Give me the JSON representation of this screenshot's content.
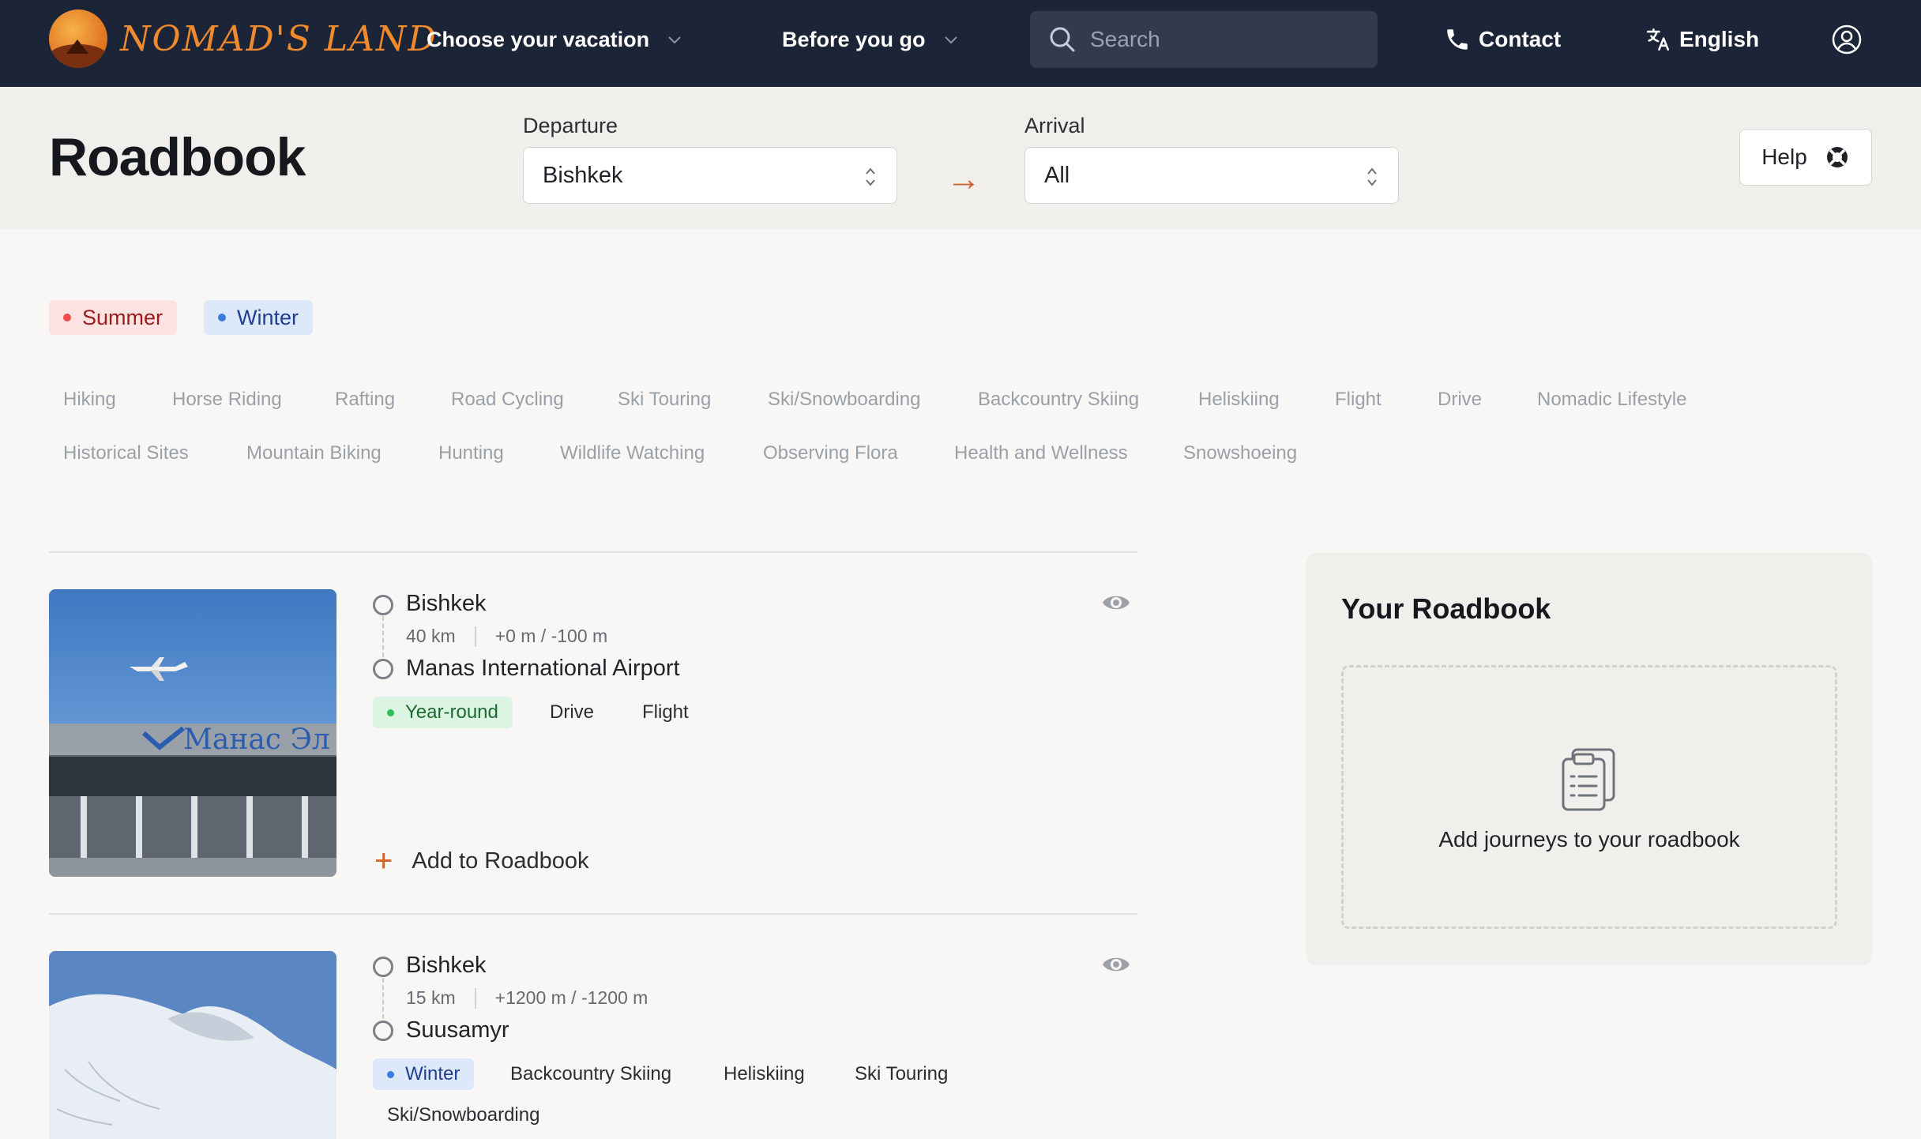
{
  "nav": {
    "logo_text": "NOMAD'S LAND",
    "choose_vacation": "Choose your vacation",
    "before_you_go": "Before you go",
    "search_placeholder": "Search",
    "contact": "Contact",
    "language": "English"
  },
  "header": {
    "title": "Roadbook",
    "departure_label": "Departure",
    "departure_value": "Bishkek",
    "arrival_label": "Arrival",
    "arrival_value": "All",
    "help_label": "Help"
  },
  "seasons": [
    "Summer",
    "Winter"
  ],
  "activities": {
    "row1": [
      "Hiking",
      "Horse Riding",
      "Rafting",
      "Road Cycling",
      "Ski Touring",
      "Ski/Snowboarding",
      "Backcountry Skiing",
      "Heliskiing",
      "Flight",
      "Drive",
      "Nomadic Lifestyle"
    ],
    "row2": [
      "Historical Sites",
      "Mountain Biking",
      "Hunting",
      "Wildlife Watching",
      "Observing Flora",
      "Health and Wellness",
      "Snowshoeing"
    ]
  },
  "journeys": [
    {
      "from": "Bishkek",
      "distance": "40 km",
      "elevation": "+0 m / -100 m",
      "to": "Manas International Airport",
      "season": "Year-round",
      "tags": [
        "Drive",
        "Flight"
      ],
      "add_label": "Add to Roadbook"
    },
    {
      "from": "Bishkek",
      "distance": "15 km",
      "elevation": "+1200 m / -1200 m",
      "to": "Suusamyr",
      "season": "Winter",
      "tags": [
        "Backcountry Skiing",
        "Heliskiing",
        "Ski Touring",
        "Ski/Snowboarding"
      ]
    }
  ],
  "roadbook_panel": {
    "title": "Your Roadbook",
    "empty_text": "Add journeys to your roadbook"
  },
  "colors": {
    "nav_bg": "#1c2537",
    "accent": "#d2632a",
    "summer": "#ef4d4d",
    "winter": "#3a7be0",
    "year_round": "#2fbf5a"
  }
}
